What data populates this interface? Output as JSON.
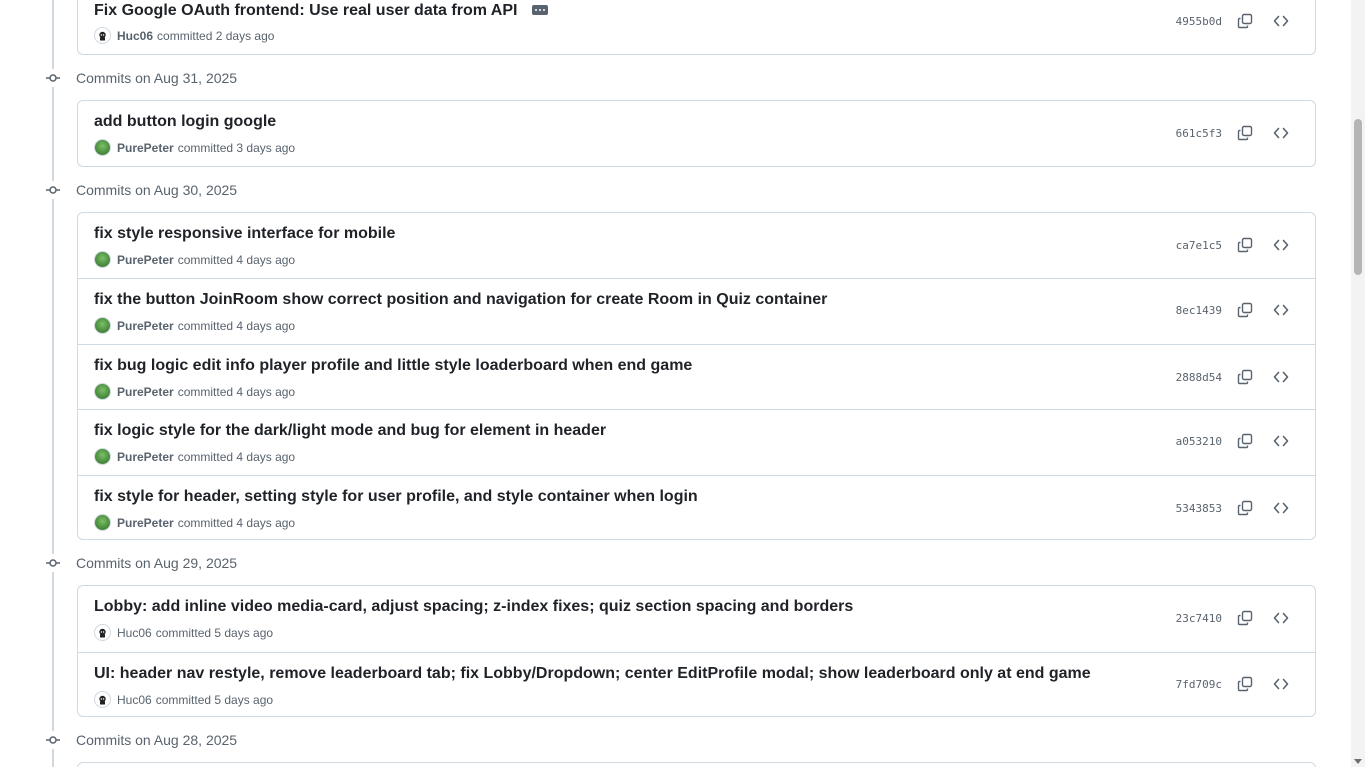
{
  "groups": [
    {
      "label": "Commits on Aug 31, 2025"
    },
    {
      "label": "Commits on Aug 30, 2025"
    },
    {
      "label": "Commits on Aug 29, 2025"
    },
    {
      "label": "Commits on Aug 28, 2025"
    }
  ],
  "commits": [
    {
      "title": "Fix Google OAuth frontend: Use real user data from API",
      "author": "Huc06",
      "when": "committed 2 days ago",
      "sha": "4955b0d"
    },
    {
      "title": "add button login google",
      "author": "PurePeter",
      "when": "committed 3 days ago",
      "sha": "661c5f3"
    },
    {
      "title": "fix style responsive interface for mobile",
      "author": "PurePeter",
      "when": "committed 4 days ago",
      "sha": "ca7e1c5"
    },
    {
      "title": "fix the button JoinRoom show correct position and navigation for create Room in Quiz container",
      "author": "PurePeter",
      "when": "committed 4 days ago",
      "sha": "8ec1439"
    },
    {
      "title": "fix bug logic edit info player profile and little style loaderboard when end game",
      "author": "PurePeter",
      "when": "committed 4 days ago",
      "sha": "2888d54"
    },
    {
      "title": "fix logic style for the dark/light mode and bug for element in header",
      "author": "PurePeter",
      "when": "committed 4 days ago",
      "sha": "a053210"
    },
    {
      "title": "fix style for header, setting style for user profile, and style container when login",
      "author": "PurePeter",
      "when": "committed 4 days ago",
      "sha": "5343853"
    },
    {
      "title": "Lobby: add inline video media-card, adjust spacing; z-index fixes; quiz section spacing and borders",
      "author": "Huc06",
      "when": "committed 5 days ago",
      "sha": "23c7410"
    },
    {
      "title": "UI: header nav restyle, remove leaderboard tab; fix Lobby/Dropdown; center EditProfile modal; show leaderboard only at end game",
      "author": "Huc06",
      "when": "committed 5 days ago",
      "sha": "7fd709c"
    }
  ]
}
